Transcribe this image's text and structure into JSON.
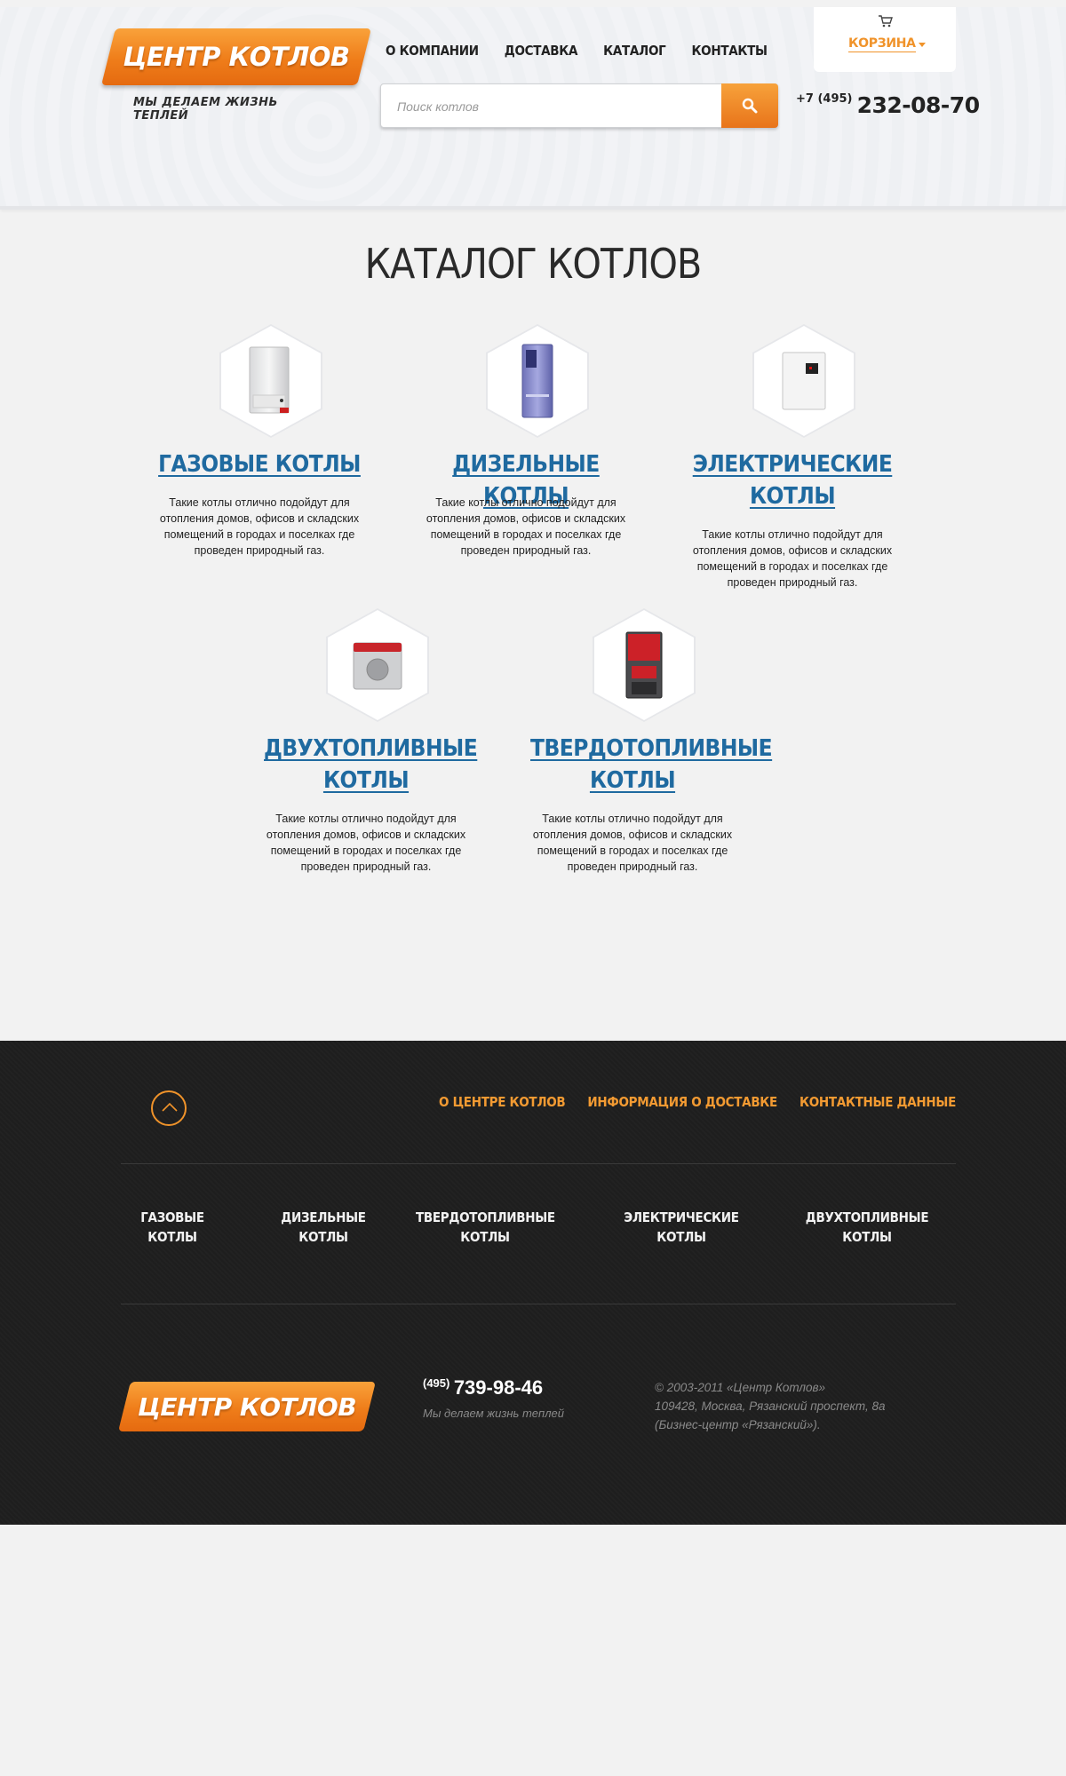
{
  "header": {
    "logo": "ЦЕНТР КОТЛОВ",
    "tagline": "МЫ ДЕЛАЕМ ЖИЗНЬ ТЕПЛЕЙ",
    "nav": [
      "О КОМПАНИИ",
      "ДОСТАВКА",
      "КАТАЛОГ",
      "КОНТАКТЫ"
    ],
    "cart_label": "КОРЗИНА",
    "search_placeholder": "Поиск котлов",
    "phone_code": "+7 (495)",
    "phone_number": "232-08-70"
  },
  "catalog": {
    "title": "КАТАЛОГ КОТЛОВ",
    "items": [
      {
        "title_lines": [
          "ГАЗОВЫЕ КОТЛЫ"
        ],
        "desc": [
          "Такие котлы отлично подойдут для",
          "отопления домов, офисов и складских",
          "помещений в городах и поселках где",
          "проведен природный газ."
        ]
      },
      {
        "title_lines": [
          "ДИЗЕЛЬНЫЕ КОТЛЫ"
        ],
        "desc": [
          "Такие котлы отлично подойдут для",
          "отопления домов, офисов и складских",
          "помещений в городах и поселках где",
          "проведен природный газ."
        ]
      },
      {
        "title_lines": [
          "ЭЛЕКТРИЧЕСКИЕ",
          "КОТЛЫ"
        ],
        "desc": [
          "Такие котлы отлично подойдут для",
          "отопления домов, офисов и складских",
          "помещений в городах и поселках где",
          "проведен природный газ."
        ]
      },
      {
        "title_lines": [
          "ДВУХТОПЛИВНЫЕ",
          "КОТЛЫ"
        ],
        "desc": [
          "Такие котлы отлично подойдут для",
          "отопления домов, офисов и складских",
          "помещений в городах и поселках где",
          "проведен природный газ."
        ]
      },
      {
        "title_lines": [
          "ТВЕРДОТОПЛИВНЫЕ",
          "КОТЛЫ"
        ],
        "desc": [
          "Такие котлы отлично подойдут для",
          "отопления домов, офисов и складских",
          "помещений в городах и поселках где",
          "проведен природный газ."
        ]
      }
    ]
  },
  "footer": {
    "links": [
      "О ЦЕНТРЕ КОТЛОВ",
      "ИНФОРМАЦИЯ О ДОСТАВКЕ",
      "КОНТАКТНЫЕ ДАННЫЕ"
    ],
    "categories": [
      [
        "ГАЗОВЫЕ",
        "КОТЛЫ"
      ],
      [
        "ДИЗЕЛЬНЫЕ",
        "КОТЛЫ"
      ],
      [
        "ТВЕРДОТОПЛИВНЫЕ",
        "КОТЛЫ"
      ],
      [
        "ЭЛЕКТРИЧЕСКИЕ",
        "КОТЛЫ"
      ],
      [
        "ДВУХТОПЛИВНЫЕ",
        "КОТЛЫ"
      ]
    ],
    "logo": "ЦЕНТР КОТЛОВ",
    "phone_code": "(495)",
    "phone_number": "739-98-46",
    "tagline": "Мы делаем жизнь теплей",
    "copyright": [
      "© 2003-2011 «Центр Котлов»",
      "109428, Москва, Рязанский проспект, 8а",
      "(Бизнес-центр «Рязанский»)."
    ]
  },
  "colors": {
    "accent": "#f0932a",
    "link_blue": "#1f6aa0",
    "footer_bg": "#1e1e1e"
  },
  "icons": [
    "cart-icon",
    "search-icon",
    "arrow-up-icon"
  ]
}
